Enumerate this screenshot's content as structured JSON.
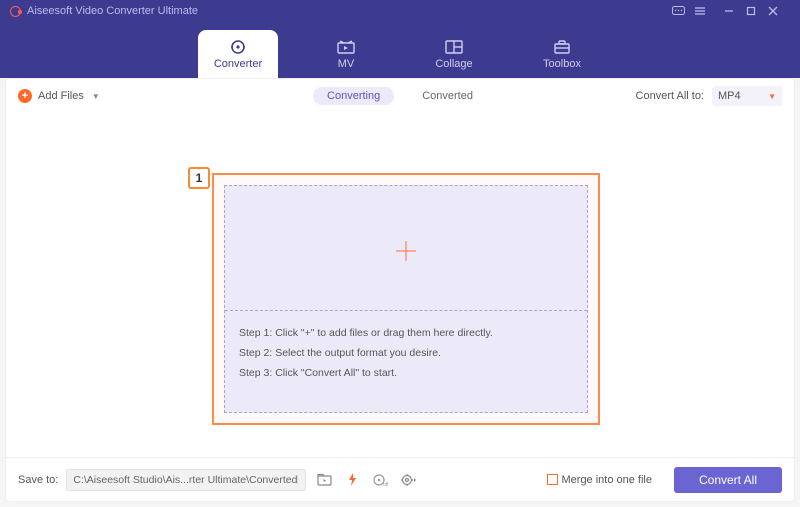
{
  "titlebar": {
    "title": "Aiseesoft Video Converter Ultimate"
  },
  "tabs": {
    "converter": "Converter",
    "mv": "MV",
    "collage": "Collage",
    "toolbox": "Toolbox"
  },
  "toolbar": {
    "add_files": "Add Files",
    "converting": "Converting",
    "converted": "Converted",
    "convert_all_to": "Convert All to:",
    "format": "MP4"
  },
  "highlight": {
    "badge": "1"
  },
  "steps": {
    "s1": "Step 1: Click \"+\" to add files or drag them here directly.",
    "s2": "Step 2: Select the output format you desire.",
    "s3": "Step 3: Click \"Convert All\" to start."
  },
  "footer": {
    "save_to_label": "Save to:",
    "path": "C:\\Aiseesoft Studio\\Ais...rter Ultimate\\Converted",
    "merge_label": "Merge into one file",
    "convert_all": "Convert All"
  }
}
